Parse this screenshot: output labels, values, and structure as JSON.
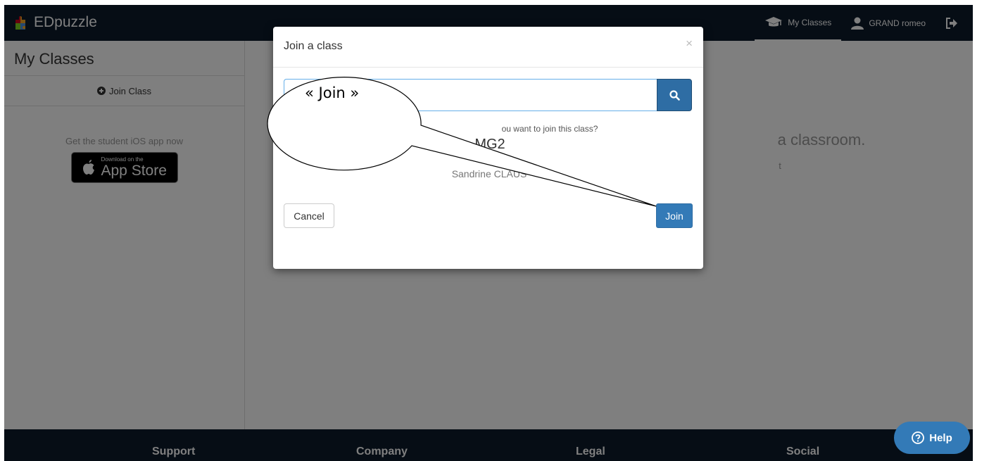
{
  "navbar": {
    "brand": "EDpuzzle",
    "my_classes": "My Classes",
    "user_name": "GRAND romeo"
  },
  "sidebar": {
    "title": "My Classes",
    "join_class": "Join Class",
    "ios_text": "Get the student iOS app now",
    "appstore_small": "Download on the",
    "appstore_big": "App Store"
  },
  "main": {
    "empty_text": "a classroom.",
    "empty_sub": "t"
  },
  "modal": {
    "title": "Join a class",
    "close_label": "×",
    "code_value": "",
    "question": "ou want to join this class?",
    "class_name": "MG2",
    "teacher": "Sandrine CLAUS",
    "cancel_label": "Cancel",
    "join_label": "Join"
  },
  "footer": {
    "support": "Support",
    "company": "Company",
    "legal": "Legal",
    "social": "Social"
  },
  "help": {
    "label": "Help"
  },
  "annotation": {
    "text": "« Join »"
  },
  "colors": {
    "navbar": "#0c1a2b",
    "primary": "#337ab7",
    "primary_dark": "#2e6da4"
  }
}
